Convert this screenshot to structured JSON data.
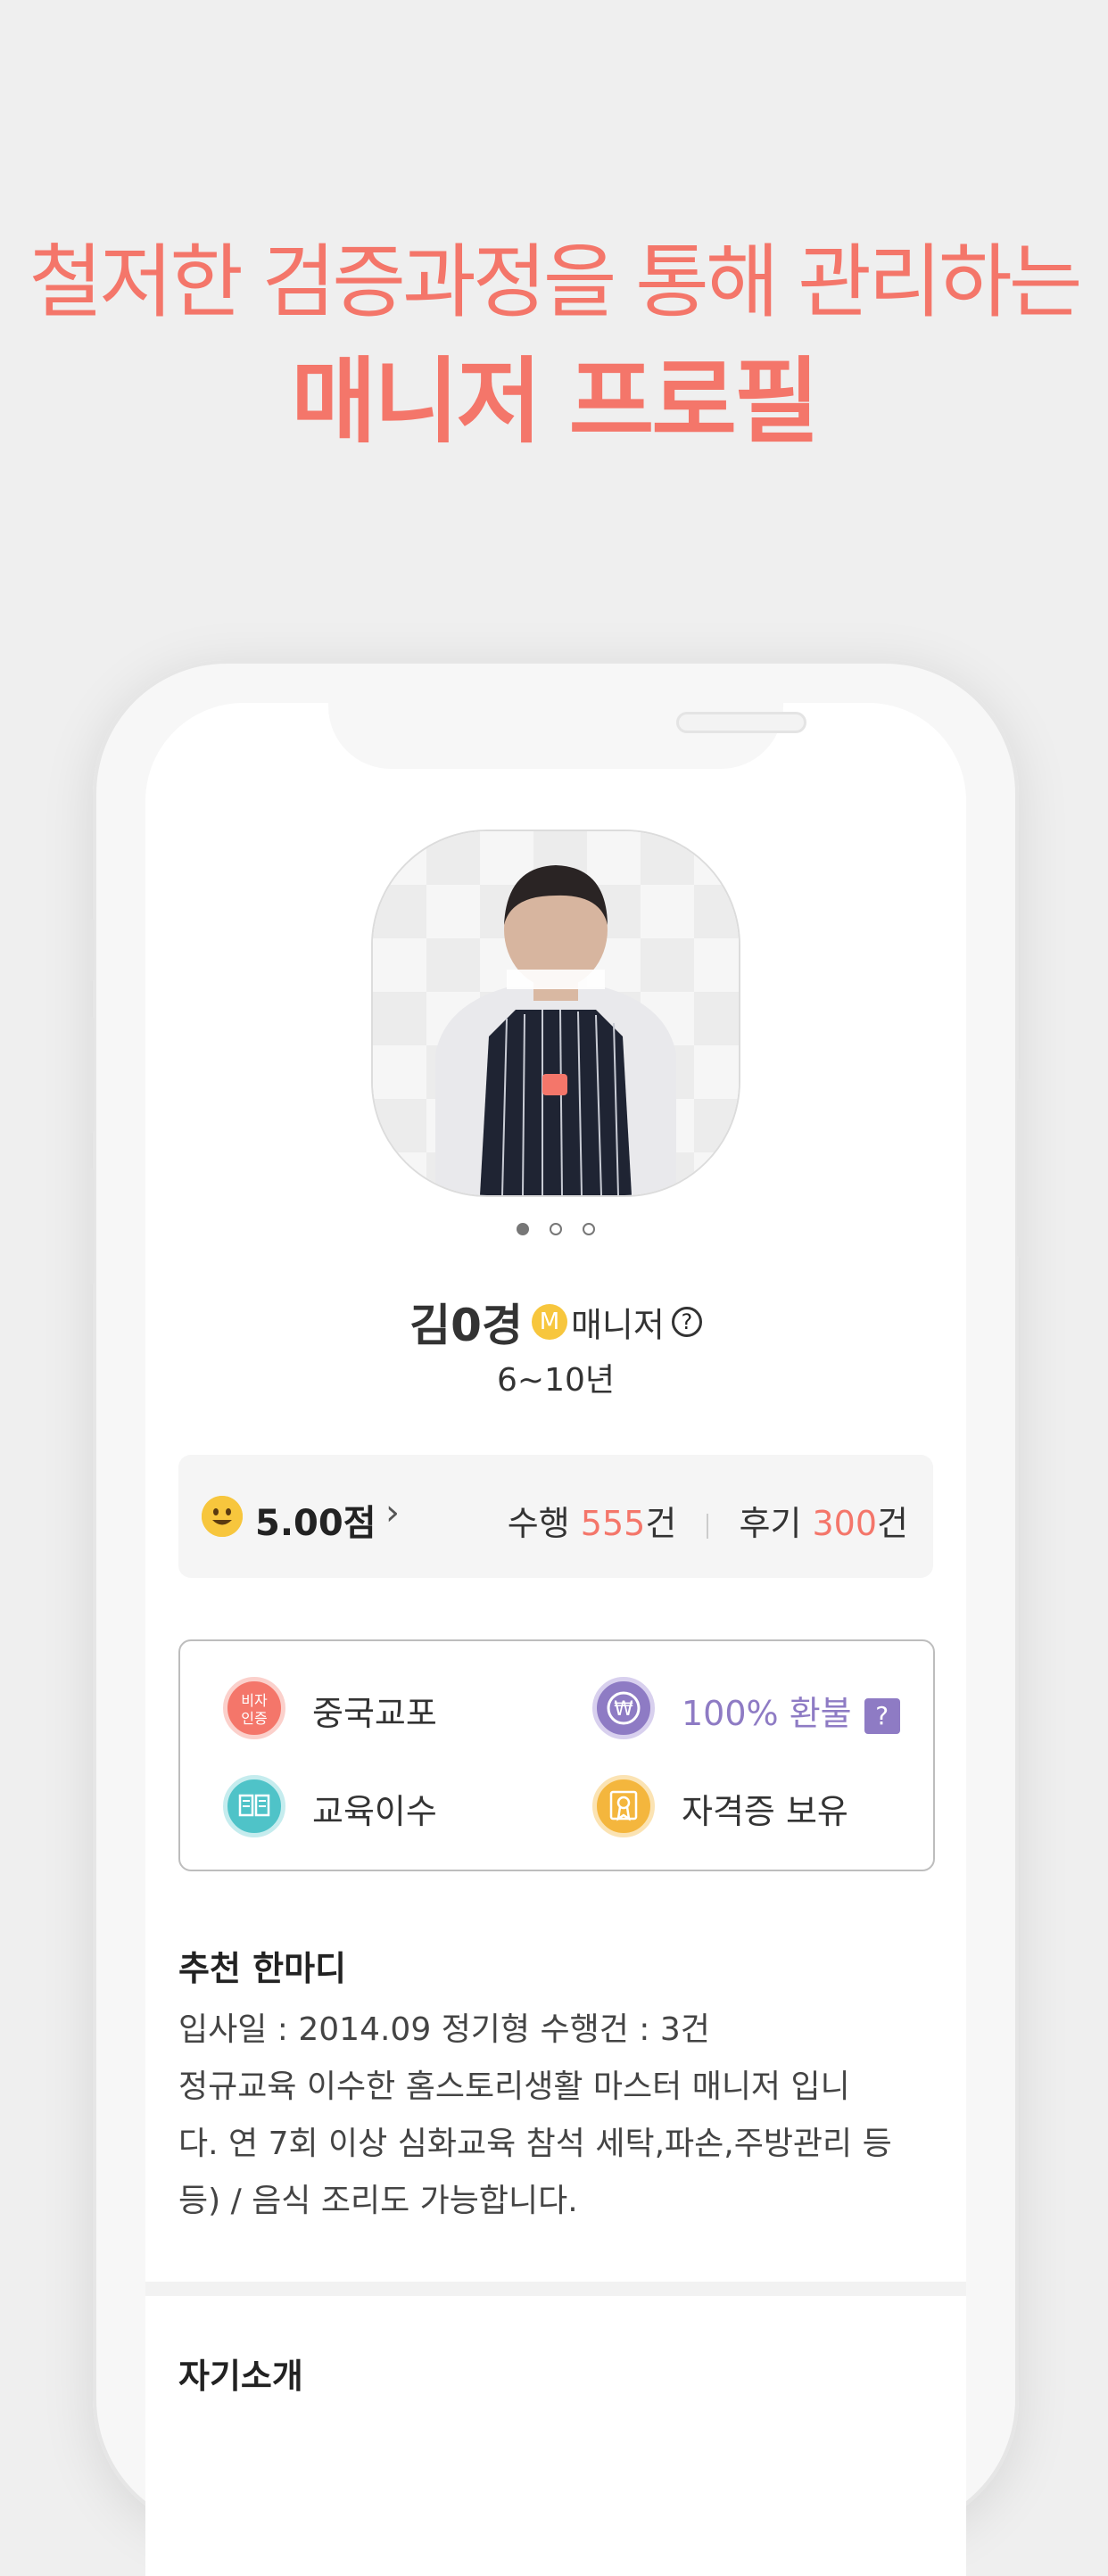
{
  "headline": {
    "line1": "철저한 검증과정을 통해 관리하는",
    "line2": "매니저 프로필"
  },
  "profile": {
    "name": "김0경",
    "grade_badge": "M",
    "role": "매니저",
    "help_icon": "?",
    "experience": "6~10년",
    "photo_slides": 3,
    "active_slide": 1
  },
  "stats": {
    "score": "5.00점",
    "chevron": "›",
    "performed_label": "수행",
    "performed_count": "555",
    "performed_unit": "건",
    "reviews_label": "후기",
    "reviews_count": "300",
    "reviews_unit": "건"
  },
  "features": {
    "visa": {
      "icon_text_1": "비자",
      "icon_text_2": "인증",
      "label": "중국교포",
      "color": "#f4766a"
    },
    "refund": {
      "icon_text": "₩",
      "label": "100% 환불",
      "help": "?",
      "color": "#8e7bc4"
    },
    "edu": {
      "label": "교육이수",
      "color": "#4fc3c8"
    },
    "cert": {
      "label": "자격증 보유",
      "color": "#f4b63d"
    }
  },
  "recommend": {
    "title": "추천 한마디",
    "line1": "입사일 : 2014.09 정기형 수행건 : 3건",
    "line2": "정규교육 이수한 홈스토리생활 마스터 매니저 입니",
    "line3": "다. 연 7회 이상 심화교육 참석 세탁,파손,주방관리 등",
    "line4": "등) / 음식 조리도 가능합니다."
  },
  "intro": {
    "title": "자기소개"
  },
  "colors": {
    "accent": "#f4766a",
    "purple": "#8e7bc4",
    "teal": "#4fc3c8",
    "gold": "#f4b63d"
  }
}
